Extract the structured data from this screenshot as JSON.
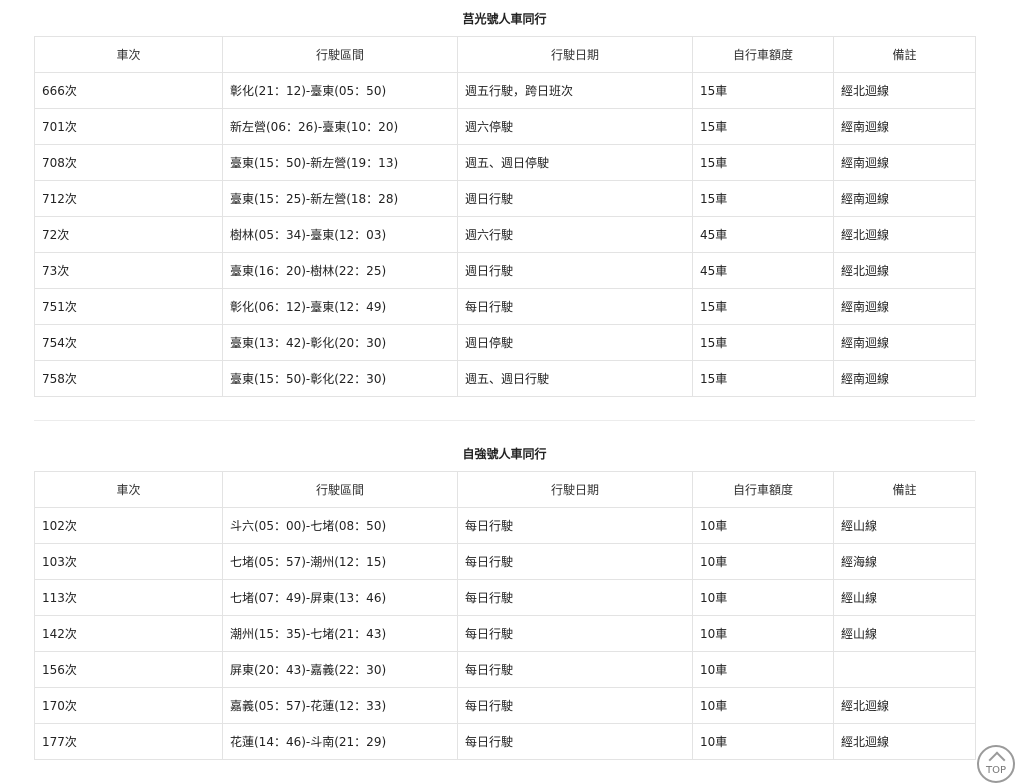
{
  "sections": [
    {
      "title": "莒光號人車同行",
      "headers": [
        "車次",
        "行駛區間",
        "行駛日期",
        "自行車額度",
        "備註"
      ],
      "rows": [
        [
          "666次",
          "彰化(21：12)-臺東(05：50)",
          "週五行駛，跨日班次",
          "15車",
          "經北迴線"
        ],
        [
          "701次",
          "新左營(06：26)-臺東(10：20)",
          "週六停駛",
          "15車",
          "經南迴線"
        ],
        [
          "708次",
          "臺東(15：50)-新左營(19：13)",
          "週五、週日停駛",
          "15車",
          "經南迴線"
        ],
        [
          "712次",
          "臺東(15：25)-新左營(18：28)",
          "週日行駛",
          "15車",
          "經南迴線"
        ],
        [
          "72次",
          "樹林(05：34)-臺東(12：03)",
          "週六行駛",
          "45車",
          "經北迴線"
        ],
        [
          "73次",
          "臺東(16：20)-樹林(22：25)",
          "週日行駛",
          "45車",
          "經北迴線"
        ],
        [
          "751次",
          "彰化(06：12)-臺東(12：49)",
          "每日行駛",
          "15車",
          "經南迴線"
        ],
        [
          "754次",
          "臺東(13：42)-彰化(20：30)",
          "週日停駛",
          "15車",
          "經南迴線"
        ],
        [
          "758次",
          "臺東(15：50)-彰化(22：30)",
          "週五、週日行駛",
          "15車",
          "經南迴線"
        ]
      ]
    },
    {
      "title": "自強號人車同行",
      "headers": [
        "車次",
        "行駛區間",
        "行駛日期",
        "自行車額度",
        "備註"
      ],
      "rows": [
        [
          "102次",
          "斗六(05：00)-七堵(08：50)",
          "每日行駛",
          "10車",
          "經山線"
        ],
        [
          "103次",
          "七堵(05：57)-潮州(12：15)",
          "每日行駛",
          "10車",
          "經海線"
        ],
        [
          "113次",
          "七堵(07：49)-屏東(13：46)",
          "每日行駛",
          "10車",
          "經山線"
        ],
        [
          "142次",
          "潮州(15：35)-七堵(21：43)",
          "每日行駛",
          "10車",
          "經山線"
        ],
        [
          "156次",
          "屏東(20：43)-嘉義(22：30)",
          "每日行駛",
          "10車",
          ""
        ],
        [
          "170次",
          "嘉義(05：57)-花蓮(12：33)",
          "每日行駛",
          "10車",
          "經北迴線"
        ],
        [
          "177次",
          "花蓮(14：46)-斗南(21：29)",
          "每日行駛",
          "10車",
          "經北迴線"
        ]
      ]
    }
  ],
  "top_button": {
    "label": "TOP",
    "icon": "chevron-up-icon"
  }
}
